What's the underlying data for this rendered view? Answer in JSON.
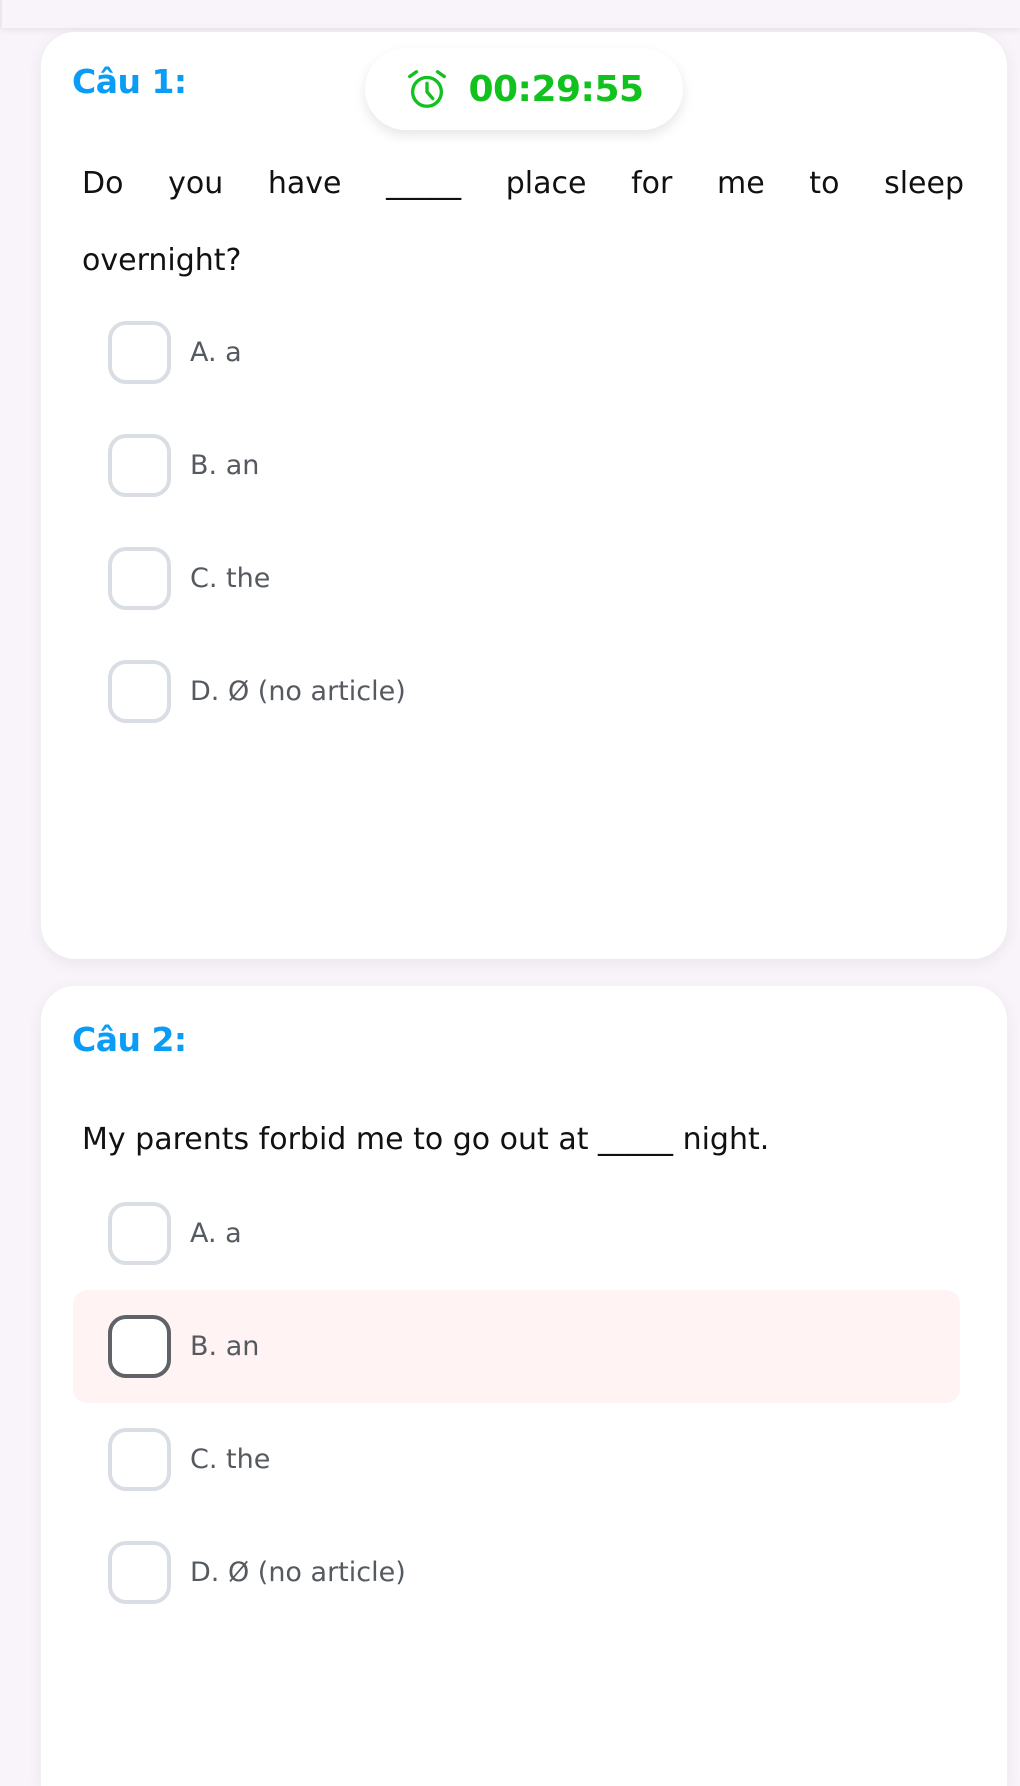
{
  "timer": {
    "icon": "alarm-clock-icon",
    "value": "00:29:55",
    "color": "#11c21e"
  },
  "colors": {
    "heading": "#0b9cf5",
    "highlight_bg": "#fff3f4",
    "option_border": "#d9dee5",
    "option_border_active": "#5f6368"
  },
  "questions": [
    {
      "heading": "Câu 1:",
      "text": "Do you have _____ place for me to sleep overnight?",
      "options": [
        {
          "label": "A. a",
          "highlighted": false
        },
        {
          "label": "B. an",
          "highlighted": false
        },
        {
          "label": "C. the",
          "highlighted": false
        },
        {
          "label": "D. Ø (no article)",
          "highlighted": false
        }
      ]
    },
    {
      "heading": "Câu 2:",
      "text": "My parents forbid me to go out at _____ night.",
      "options": [
        {
          "label": "A. a",
          "highlighted": false
        },
        {
          "label": "B. an",
          "highlighted": true
        },
        {
          "label": "C. the",
          "highlighted": false
        },
        {
          "label": "D. Ø (no article)",
          "highlighted": false
        }
      ]
    }
  ]
}
